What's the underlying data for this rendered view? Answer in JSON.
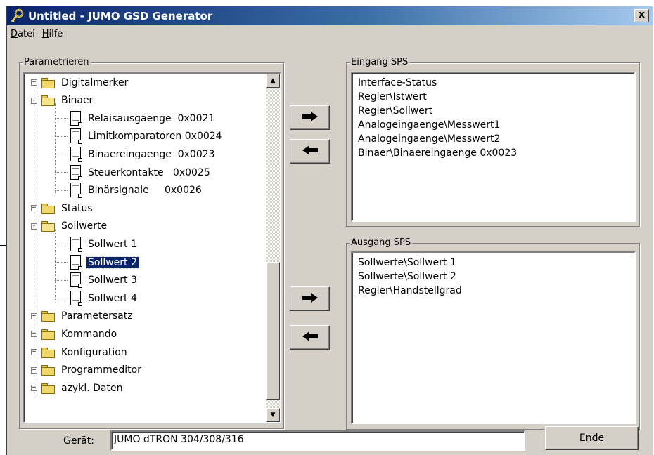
{
  "window": {
    "title": "Untitled - JUMO GSD Generator",
    "close_label": "x"
  },
  "menu": [
    {
      "key": "D",
      "rest": "atei"
    },
    {
      "key": "H",
      "rest": "ilfe"
    }
  ],
  "tree_panel": {
    "label": "Parametrieren",
    "nodes": [
      {
        "label": "Digitalmerker",
        "type": "folder",
        "expander": "+"
      },
      {
        "label": "Binaer",
        "type": "folder-open",
        "expander": "-"
      },
      {
        "label": "Relaisausgaenge  0x0021",
        "type": "doc"
      },
      {
        "label": "Limitkomparatoren 0x0024",
        "type": "doc"
      },
      {
        "label": "Binaereingaenge  0x0023",
        "type": "doc"
      },
      {
        "label": "Steuerkontakte   0x0025",
        "type": "doc"
      },
      {
        "label": "Binärsignale     0x0026",
        "type": "doc"
      },
      {
        "label": "Status",
        "type": "folder",
        "expander": "+"
      },
      {
        "label": "Sollwerte",
        "type": "folder-open",
        "expander": "-"
      },
      {
        "label": "Sollwert 1",
        "type": "doc"
      },
      {
        "label": "Sollwert 2",
        "type": "doc",
        "selected": true
      },
      {
        "label": "Sollwert 3",
        "type": "doc"
      },
      {
        "label": "Sollwert 4",
        "type": "doc"
      },
      {
        "label": "Parametersatz",
        "type": "folder",
        "expander": "+"
      },
      {
        "label": "Kommando",
        "type": "folder",
        "expander": "+"
      },
      {
        "label": "Konfiguration",
        "type": "folder",
        "expander": "+"
      },
      {
        "label": "Programmeditor",
        "type": "folder",
        "expander": "+"
      },
      {
        "label": "azykl. Daten",
        "type": "folder",
        "expander": "+"
      }
    ]
  },
  "arrows": {
    "right": "🡆",
    "left": "🡄"
  },
  "input_panel": {
    "label": "Eingang SPS",
    "items": [
      "Interface-Status",
      "Regler\\Istwert",
      "Regler\\Sollwert",
      "Analogeingaenge\\Messwert1",
      "Analogeingaenge\\Messwert2",
      "Binaer\\Binaereingaenge  0x0023"
    ]
  },
  "output_panel": {
    "label": "Ausgang SPS",
    "items": [
      "Sollwerte\\Sollwert 1",
      "Sollwerte\\Sollwert 2",
      "Regler\\Handstellgrad"
    ]
  },
  "device": {
    "label": "Gerät:",
    "value": "JUMO dTRON 304/308/316"
  },
  "end_button": {
    "key": "E",
    "rest": "nde"
  },
  "colors": {
    "selection": "#0a246a",
    "face": "#d4d0c8",
    "title_start": "#0a246a"
  }
}
